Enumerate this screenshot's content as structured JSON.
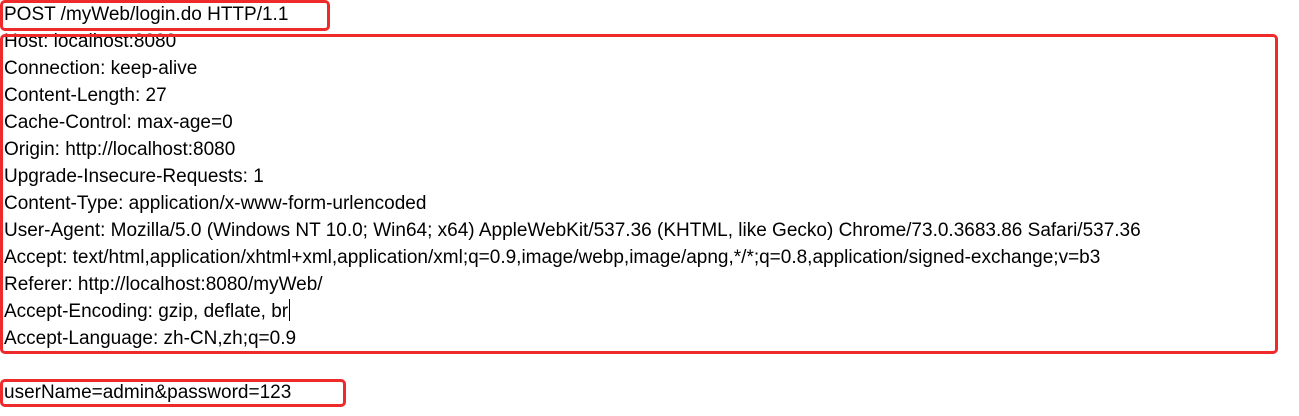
{
  "request_line": "POST /myWeb/login.do HTTP/1.1",
  "headers": [
    "Host: localhost:8080",
    "Connection: keep-alive",
    "Content-Length: 27",
    "Cache-Control: max-age=0",
    "Origin: http://localhost:8080",
    "Upgrade-Insecure-Requests: 1",
    "Content-Type: application/x-www-form-urlencoded",
    "User-Agent: Mozilla/5.0 (Windows NT 10.0; Win64; x64) AppleWebKit/537.36 (KHTML, like Gecko) Chrome/73.0.3683.86 Safari/537.36",
    "Accept: text/html,application/xhtml+xml,application/xml;q=0.9,image/webp,image/apng,*/*;q=0.8,application/signed-exchange;v=b3",
    "Referer: http://localhost:8080/myWeb/",
    "Accept-Encoding: gzip, deflate, br",
    "Accept-Language: zh-CN,zh;q=0.9"
  ],
  "body": "userName=admin&password=123",
  "colors": {
    "highlight_border": "#ee2a2a",
    "text": "#000000",
    "background": "#ffffff"
  }
}
